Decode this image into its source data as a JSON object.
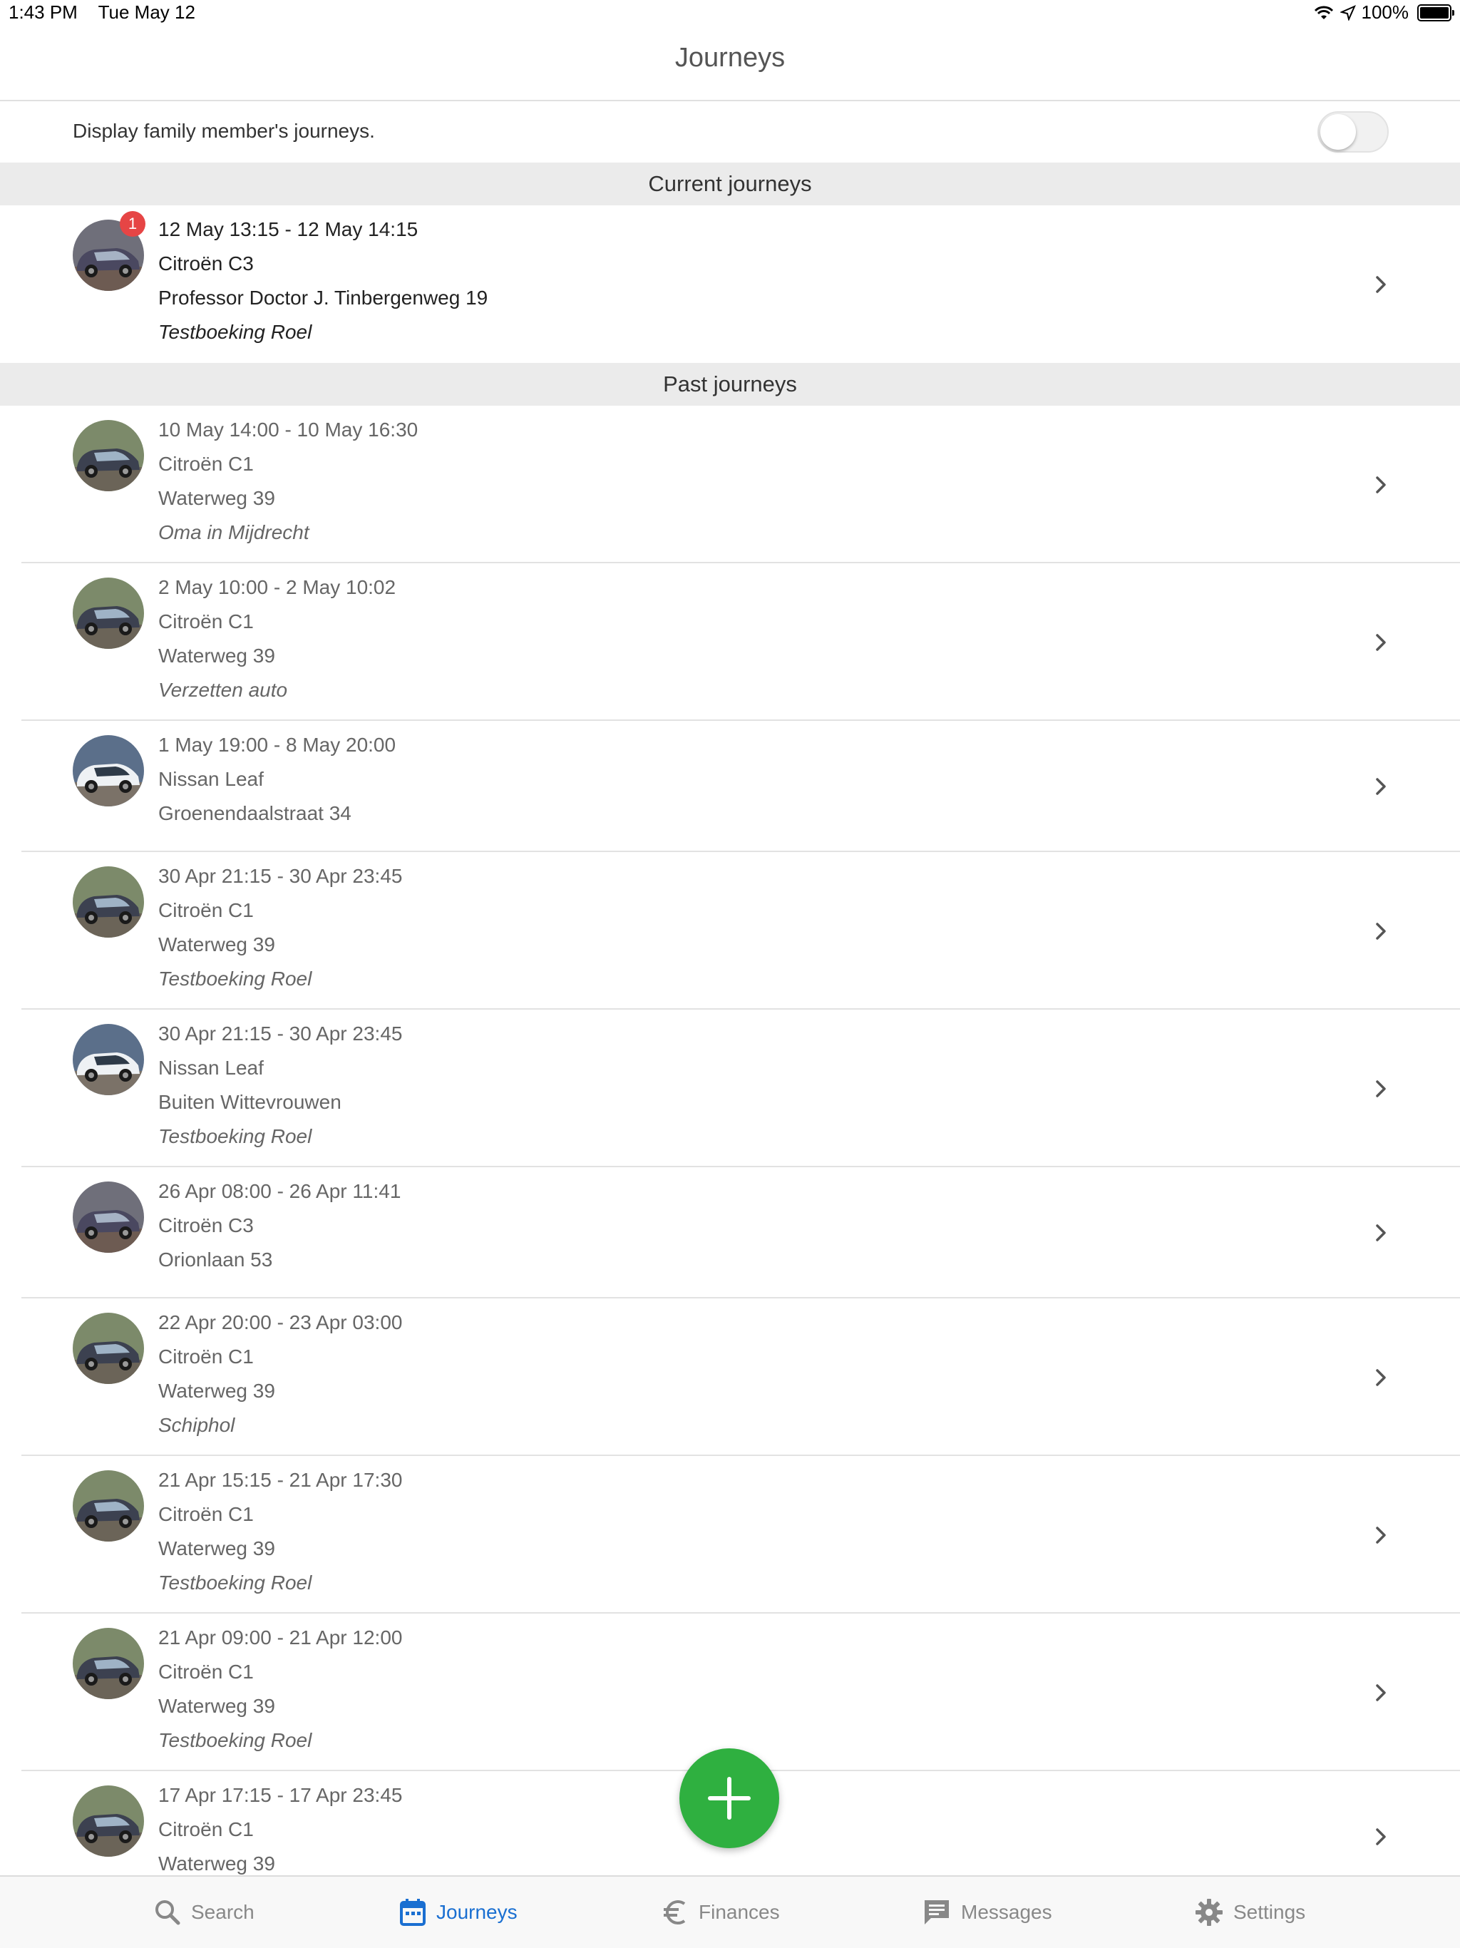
{
  "status_bar": {
    "time": "1:43 PM",
    "date": "Tue May 12",
    "battery": "100%"
  },
  "title": "Journeys",
  "family_toggle": {
    "label": "Display family member's journeys.",
    "on": false
  },
  "sections": {
    "current": "Current journeys",
    "past": "Past journeys"
  },
  "current_journeys": [
    {
      "time": "12 May 13:15 - 12 May 14:15",
      "car": "Citroën C3",
      "address": "Professor Doctor J. Tinbergenweg 19",
      "note": "Testboeking Roel",
      "badge": "1",
      "photo": "citroen-c3-icon"
    }
  ],
  "past_journeys": [
    {
      "time": "10 May 14:00 - 10 May 16:30",
      "car": "Citroën C1",
      "address": "Waterweg 39",
      "note": "Oma in Mijdrecht",
      "photo": "citroen-c1-icon"
    },
    {
      "time": "2 May 10:00 - 2 May 10:02",
      "car": "Citroën C1",
      "address": "Waterweg 39",
      "note": "Verzetten auto",
      "photo": "citroen-c1-icon"
    },
    {
      "time": "1 May 19:00 - 8 May 20:00",
      "car": "Nissan Leaf",
      "address": "Groenendaalstraat 34",
      "note": "",
      "photo": "nissan-leaf-icon"
    },
    {
      "time": "30 Apr 21:15 - 30 Apr 23:45",
      "car": "Citroën C1",
      "address": "Waterweg 39",
      "note": "Testboeking Roel",
      "photo": "citroen-c1-icon"
    },
    {
      "time": "30 Apr 21:15 - 30 Apr 23:45",
      "car": "Nissan Leaf",
      "address": "Buiten Wittevrouwen",
      "note": "Testboeking Roel",
      "photo": "nissan-leaf-icon"
    },
    {
      "time": "26 Apr 08:00 - 26 Apr 11:41",
      "car": "Citroën C3",
      "address": "Orionlaan 53",
      "note": "",
      "photo": "citroen-c3-icon"
    },
    {
      "time": "22 Apr 20:00 - 23 Apr 03:00",
      "car": "Citroën C1",
      "address": "Waterweg 39",
      "note": "Schiphol",
      "photo": "citroen-c1-icon"
    },
    {
      "time": "21 Apr 15:15 - 21 Apr 17:30",
      "car": "Citroën C1",
      "address": "Waterweg 39",
      "note": "Testboeking Roel",
      "photo": "citroen-c1-icon"
    },
    {
      "time": "21 Apr 09:00 - 21 Apr 12:00",
      "car": "Citroën C1",
      "address": "Waterweg 39",
      "note": "Testboeking Roel",
      "photo": "citroen-c1-icon"
    },
    {
      "time": "17 Apr 17:15 - 17 Apr 23:45",
      "car": "Citroën C1",
      "address": "Waterweg 39",
      "note": "",
      "photo": "citroen-c1-icon"
    }
  ],
  "tabs": [
    {
      "label": "Search",
      "icon": "search-icon",
      "active": false
    },
    {
      "label": "Journeys",
      "icon": "calendar-icon",
      "active": true
    },
    {
      "label": "Finances",
      "icon": "euro-icon",
      "active": false
    },
    {
      "label": "Messages",
      "icon": "message-icon",
      "active": false
    },
    {
      "label": "Settings",
      "icon": "gear-icon",
      "active": false
    }
  ],
  "colors": {
    "accent": "#1a6fd1",
    "fab": "#2fb040",
    "badge": "#e64545",
    "section_bg": "#ebebeb"
  }
}
